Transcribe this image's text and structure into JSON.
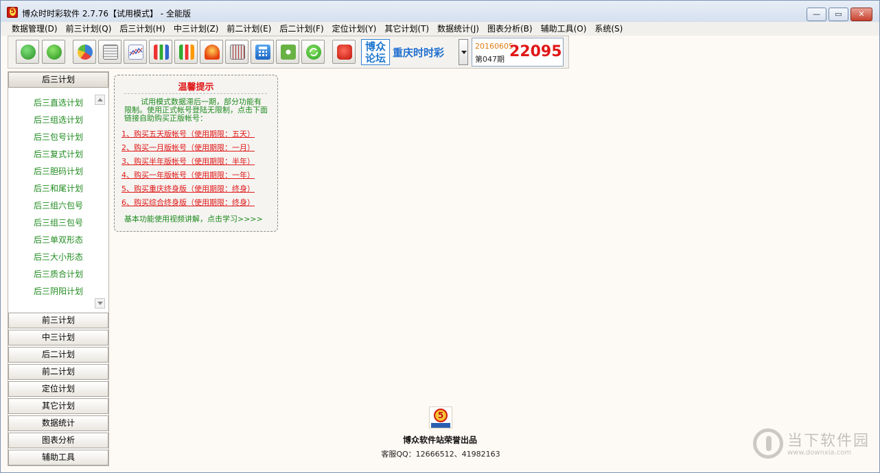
{
  "window": {
    "title": "博众时时彩软件 2.7.76【试用模式】 - 全能版",
    "minimize_glyph": "—",
    "maximize_glyph": "▭",
    "close_glyph": "✕"
  },
  "menu": [
    "数据管理(D)",
    "前三计划(Q)",
    "后三计划(H)",
    "中三计划(Z)",
    "前二计划(E)",
    "后二计划(F)",
    "定位计划(Y)",
    "其它计划(T)",
    "数据统计(J)",
    "图表分析(B)",
    "辅助工具(O)",
    "系统(S)"
  ],
  "toolbar": {
    "icons": [
      "database-icon",
      "download-icon",
      "pie-chart-icon",
      "grid-table-icon",
      "line-chart-icon",
      "bar-chart-icon",
      "bar-chart-alt-icon",
      "alarm-icon",
      "grid-chart-icon",
      "calculator-icon",
      "settings-icon",
      "refresh-icon",
      "red-button-icon"
    ],
    "forum_logo_line1": "博众",
    "forum_logo_line2": "论坛",
    "lottery_name": "重庆时时彩",
    "draw_date": "20160605",
    "draw_period": "第047期",
    "draw_number": "22095"
  },
  "sidebar": {
    "active_header": "后三计划",
    "items": [
      "后三直选计划",
      "后三组选计划",
      "后三包号计划",
      "后三复式计划",
      "后三胆码计划",
      "后三和尾计划",
      "后三组六包号",
      "后三组三包号",
      "后三单双形态",
      "后三大小形态",
      "后三质合计划",
      "后三阴阳计划"
    ],
    "headers": [
      "前三计划",
      "中三计划",
      "后二计划",
      "前二计划",
      "定位计划",
      "其它计划",
      "数据统计",
      "图表分析",
      "辅助工具"
    ]
  },
  "notice": {
    "title": "温馨提示",
    "body": "试用模式数据滞后一期，部分功能有限制。使用正式帐号登陆无限制，点击下面链接自助购买正版帐号：",
    "links": [
      "1、购买五天版帐号（使用期限：五天）",
      "2、购买一月版帐号（使用期限：一月）",
      "3、购买半年版帐号（使用期限：半年）",
      "4、购买一年版帐号（使用期限：一年）",
      "5、购买重庆终身版（使用期限：终身）",
      "6、购买综合终身版（使用期限：终身）"
    ],
    "footer": "基本功能使用视频讲解，点击学习>>>>"
  },
  "brand": {
    "logo_digit": "5",
    "title": "博众软件站荣誉出品",
    "qq": "客服QQ：12666512、41982163"
  },
  "watermark": {
    "text": "当下软件园",
    "url": "www.downxia.com"
  }
}
